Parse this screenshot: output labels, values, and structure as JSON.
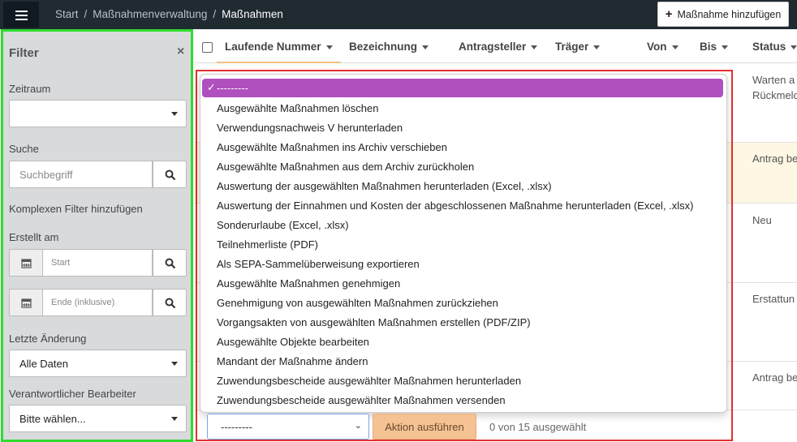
{
  "header": {
    "breadcrumb": [
      "Start",
      "Maßnahmenverwaltung",
      "Maßnahmen"
    ],
    "breadcrumb_separator": "/",
    "add_button_label": "Maßnahme hinzufügen"
  },
  "filter": {
    "title": "Filter",
    "zeitraum_label": "Zeitraum",
    "zeitraum_value": "",
    "suche_label": "Suche",
    "suche_placeholder": "Suchbegriff",
    "complex_filter_label": "Komplexen Filter hinzufügen",
    "erstellt_label": "Erstellt am",
    "start_placeholder": "Start",
    "end_placeholder": "Ende (inklusive)",
    "letzte_label": "Letzte Änderung",
    "letzte_value": "Alle Daten",
    "bearbeiter_label": "Verantwortlicher Bearbeiter",
    "bearbeiter_value": "Bitte wählen..."
  },
  "table": {
    "columns": [
      "Laufende Nummer",
      "Bezeichnung",
      "Antragsteller",
      "Träger",
      "Von",
      "Bis",
      "Status"
    ],
    "statuses": [
      "Warten a",
      "Rückmeld",
      "Antrag be",
      "Neu",
      "Erstattun",
      "Antrag be"
    ]
  },
  "dropdown": {
    "selected": "---------",
    "options": [
      "Ausgewählte Maßnahmen löschen",
      "Verwendungsnachweis V herunterladen",
      "Ausgewählte Maßnahmen ins Archiv verschieben",
      "Ausgewählte Maßnahmen aus dem Archiv zurückholen",
      "Auswertung der ausgewählten Maßnahmen herunterladen (Excel, .xlsx)",
      "Auswertung der Einnahmen und Kosten der abgeschlossenen Maßnahme herunterladen (Excel, .xlsx)",
      "Sonderurlaube (Excel, .xlsx)",
      "Teilnehmerliste (PDF)",
      "Als SEPA-Sammelüberweisung exportieren",
      "Ausgewählte Maßnahmen genehmigen",
      "Genehmigung von ausgewählten Maßnahmen zurückziehen",
      "Vorgangsakten von ausgewählten Maßnahmen erstellen (PDF/ZIP)",
      "Ausgewählte Objekte bearbeiten",
      "Mandant der Maßnahme ändern",
      "Zuwendungsbescheide ausgewählter Maßnahmen herunterladen",
      "Zuwendungsbescheide ausgewählter Maßnahmen versenden"
    ]
  },
  "actions": {
    "select_value": "---------",
    "execute_label": "Aktion ausführen",
    "selection_count": "0 von 15 ausgewählt"
  },
  "colors": {
    "topbar": "#1f2a31",
    "selected_option": "#b04fbe",
    "action_button": "#f4c293",
    "filter_highlight": "#2fdc2f",
    "dropdown_highlight": "#e53030"
  }
}
